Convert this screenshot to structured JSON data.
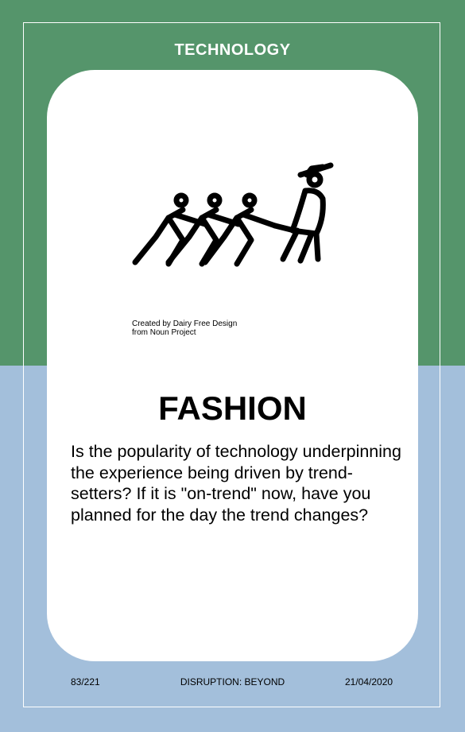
{
  "card": {
    "category": "TECHNOLOGY",
    "title": "FASHION",
    "body": "Is the popularity of technology underpinning the experience being driven by trend-setters? If it is \"on-trend\" now, have you planned for the day the trend changes?",
    "credit_line1": "Created by Dairy Free Design",
    "credit_line2": "from Noun Project",
    "illustration_icon": "people-following-trend-setter-icon"
  },
  "footer": {
    "page": "83/221",
    "series": "DISRUPTION: BEYOND",
    "date": "21/04/2020"
  },
  "colors": {
    "top_band": "#55956b",
    "bottom_band": "#a3bfdb",
    "card": "#ffffff"
  }
}
